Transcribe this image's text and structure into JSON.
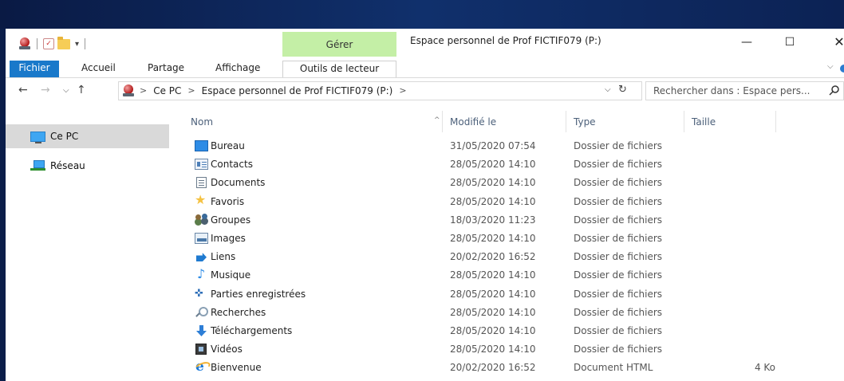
{
  "window": {
    "title": "Espace personnel de Prof FICTIF079 (P:)",
    "contextual_tab": "Gérer",
    "minimize_glyph": "—",
    "maximize_glyph": "☐",
    "close_glyph": "✕"
  },
  "quick_access": {
    "dropdown_glyph": "▾"
  },
  "ribbon": {
    "tabs": [
      {
        "label": "Fichier",
        "active": true
      },
      {
        "label": "Accueil"
      },
      {
        "label": "Partage"
      },
      {
        "label": "Affichage"
      },
      {
        "label": "Outils de lecteur"
      }
    ],
    "collapse_glyph": "⌵"
  },
  "nav": {
    "back_glyph": "←",
    "forward_glyph": "→",
    "recent_glyph": "⌵",
    "up_glyph": "↑",
    "refresh_glyph": "↻",
    "dropdown_glyph": "⌵"
  },
  "address": {
    "crumbs": [
      "Ce PC",
      "Espace personnel de Prof FICTIF079 (P:)"
    ],
    "separator": ">"
  },
  "search": {
    "placeholder": "Rechercher dans : Espace pers..."
  },
  "navpane": {
    "items": [
      {
        "label": "Ce PC",
        "icon": "monitor-icon",
        "selected": true
      },
      {
        "label": "Réseau",
        "icon": "network-icon"
      }
    ]
  },
  "columns": {
    "name": "Nom",
    "modified": "Modifié le",
    "type": "Type",
    "size": "Taille",
    "sort_glyph": "^"
  },
  "files": [
    {
      "name": "Bureau",
      "modified": "31/05/2020 07:54",
      "type": "Dossier de fichiers",
      "size": "",
      "icon": "desktop-folder-icon"
    },
    {
      "name": "Contacts",
      "modified": "28/05/2020 14:10",
      "type": "Dossier de fichiers",
      "size": "",
      "icon": "contacts-folder-icon"
    },
    {
      "name": "Documents",
      "modified": "28/05/2020 14:10",
      "type": "Dossier de fichiers",
      "size": "",
      "icon": "documents-folder-icon"
    },
    {
      "name": "Favoris",
      "modified": "28/05/2020 14:10",
      "type": "Dossier de fichiers",
      "size": "",
      "icon": "favorites-star-icon"
    },
    {
      "name": "Groupes",
      "modified": "18/03/2020 11:23",
      "type": "Dossier de fichiers",
      "size": "",
      "icon": "groups-people-icon"
    },
    {
      "name": "Images",
      "modified": "28/05/2020 14:10",
      "type": "Dossier de fichiers",
      "size": "",
      "icon": "pictures-folder-icon"
    },
    {
      "name": "Liens",
      "modified": "20/02/2020 16:52",
      "type": "Dossier de fichiers",
      "size": "",
      "icon": "links-arrow-icon"
    },
    {
      "name": "Musique",
      "modified": "28/05/2020 14:10",
      "type": "Dossier de fichiers",
      "size": "",
      "icon": "music-note-icon"
    },
    {
      "name": "Parties enregistrées",
      "modified": "28/05/2020 14:10",
      "type": "Dossier de fichiers",
      "size": "",
      "icon": "saved-games-icon"
    },
    {
      "name": "Recherches",
      "modified": "28/05/2020 14:10",
      "type": "Dossier de fichiers",
      "size": "",
      "icon": "searches-magnifier-icon"
    },
    {
      "name": "Téléchargements",
      "modified": "28/05/2020 14:10",
      "type": "Dossier de fichiers",
      "size": "",
      "icon": "downloads-arrow-icon"
    },
    {
      "name": "Vidéos",
      "modified": "28/05/2020 14:10",
      "type": "Dossier de fichiers",
      "size": "",
      "icon": "videos-folder-icon"
    },
    {
      "name": "Bienvenue",
      "modified": "20/02/2020 16:52",
      "type": "Document HTML",
      "size": "4 Ko",
      "icon": "internet-explorer-icon"
    }
  ],
  "colors": {
    "file_tab": "#1979ca",
    "manage_tab": "#c4efa6",
    "selection": "#d9d9d9"
  }
}
